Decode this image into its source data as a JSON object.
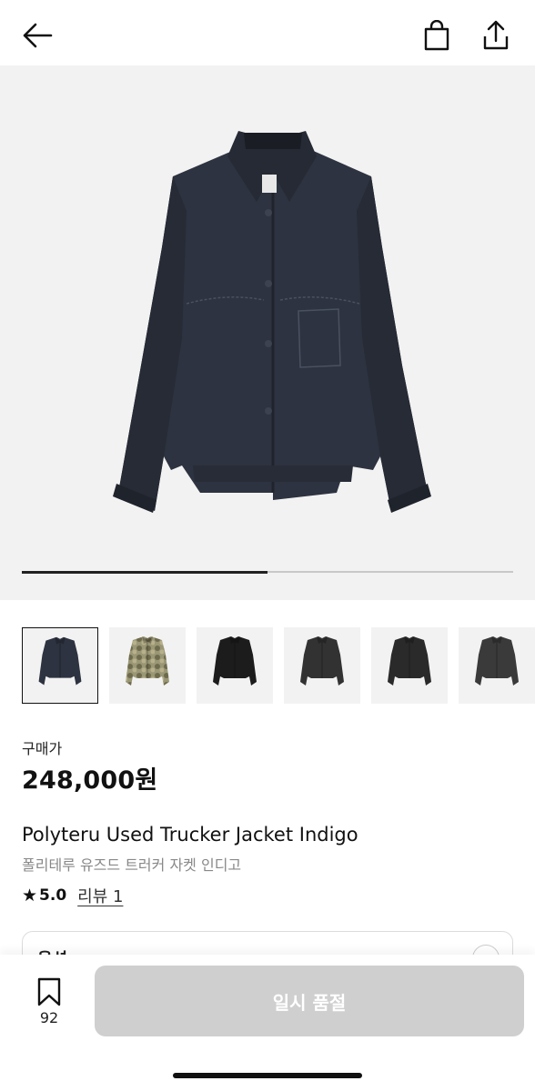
{
  "header": {
    "back_icon": "arrow-left-icon",
    "bag_icon": "shopping-bag-icon",
    "share_icon": "share-upload-icon"
  },
  "gallery": {
    "image_count": 2,
    "current_index": 1,
    "progress_fraction": 0.5,
    "thumbnails": [
      {
        "description": "indigo-jacket",
        "color": "#2d3340",
        "active": true
      },
      {
        "description": "camo-jacket",
        "color": "#8a8a6a",
        "active": false
      },
      {
        "description": "black-jacket",
        "color": "#1c1c1c",
        "active": false
      },
      {
        "description": "charcoal-jacket",
        "color": "#323232",
        "active": false
      },
      {
        "description": "dark-jacket",
        "color": "#2a2a2a",
        "active": false
      },
      {
        "description": "washed-black-jacket",
        "color": "#3a3a3a",
        "active": false
      }
    ]
  },
  "price": {
    "label": "구매가",
    "value": "248,000원"
  },
  "product": {
    "title": "Polyteru Used Trucker Jacket Indigo",
    "subtitle": "폴리테루 유즈드 트러커 자켓 인디고"
  },
  "rating": {
    "star_icon": "star-icon",
    "value": "5.0",
    "review_label": "리뷰 1"
  },
  "options": {
    "label": "옵션"
  },
  "bottom_bar": {
    "bookmark_icon": "bookmark-icon",
    "bookmark_count": "92",
    "buy_label": "일시 품절"
  },
  "colors": {
    "button_disabled": "#cfcfcf",
    "hero_bg": "#f2f2f2",
    "jacket": "#2d3340"
  }
}
